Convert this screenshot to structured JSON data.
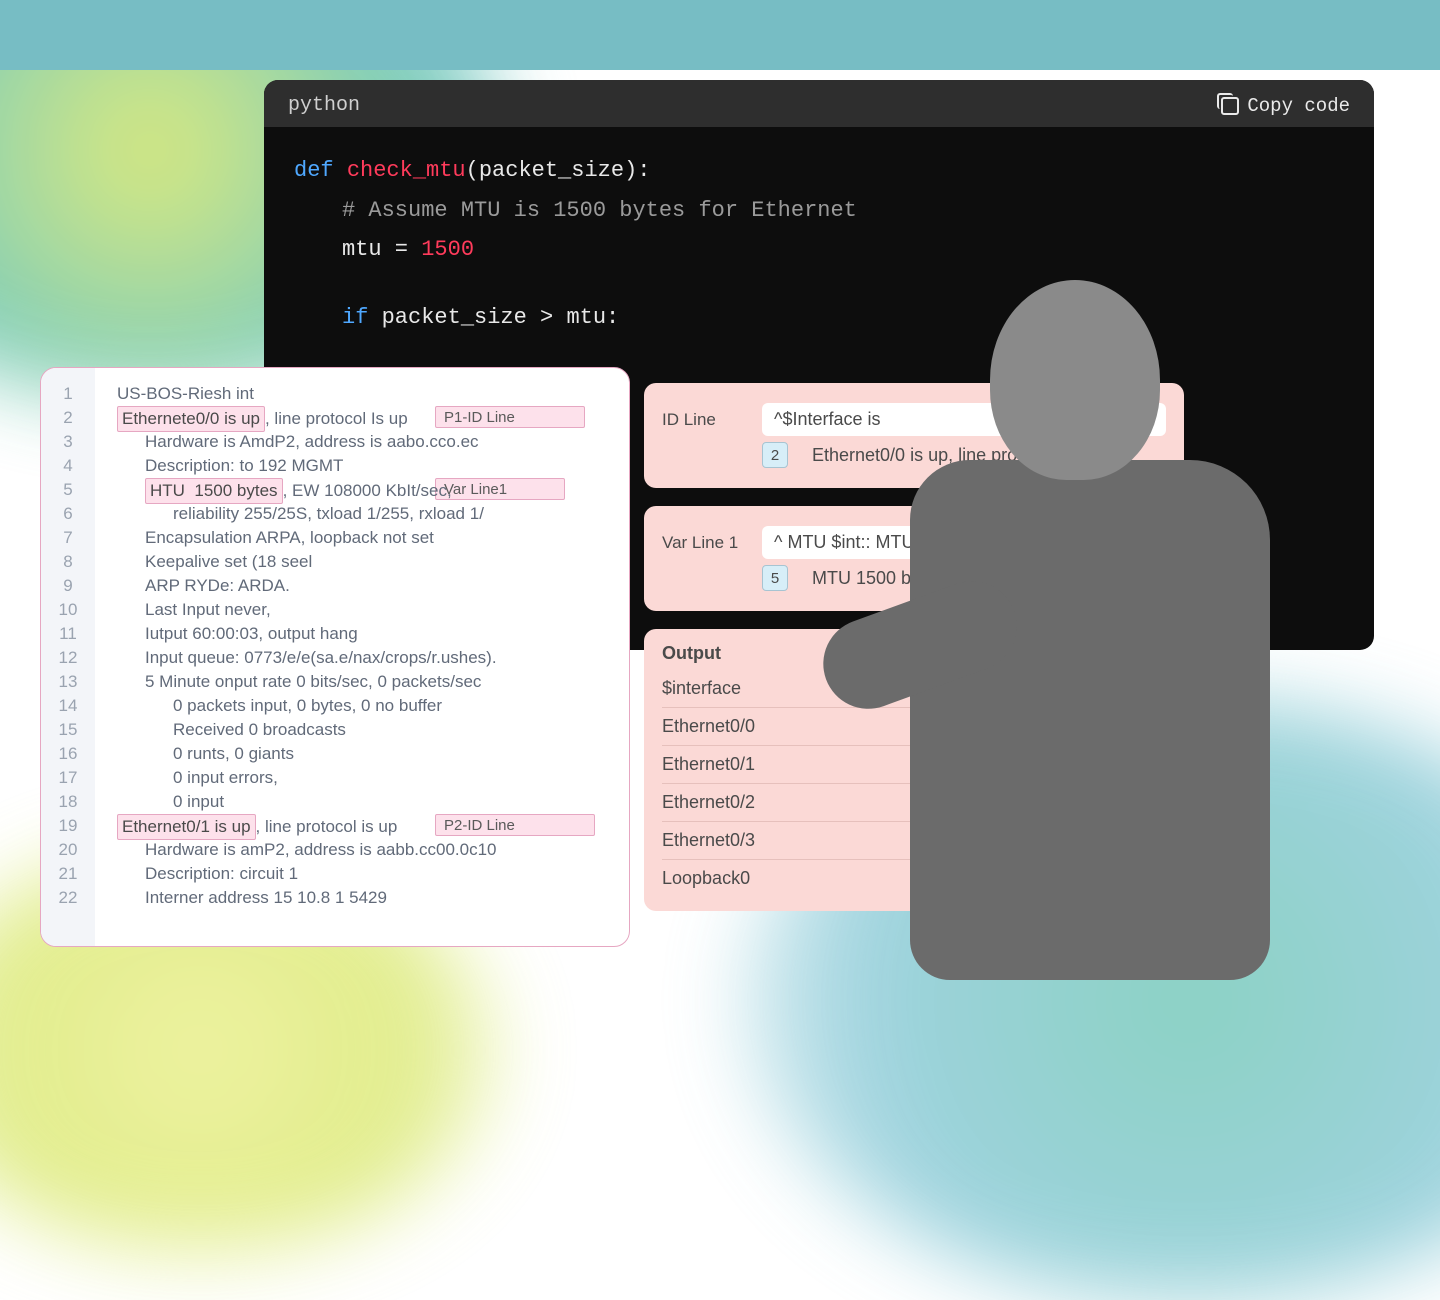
{
  "code_panel": {
    "language_label": "python",
    "copy_label": "Copy code",
    "code": {
      "kw_def": "def",
      "fn": "check_mtu",
      "args": "(packet_size):",
      "comment": "# Assume MTU is 1500 bytes for Ethernet",
      "assign_lhs": "mtu = ",
      "assign_num": "1500",
      "kw_if": "if",
      "cond": " packet_size > mtu:"
    }
  },
  "left_panel": {
    "line_numbers": [
      "1",
      "2",
      "3",
      "4",
      "5",
      "6",
      "7",
      "8",
      "9",
      "10",
      "11",
      "12",
      "13",
      "14",
      "15",
      "16",
      "17",
      "18",
      "19",
      "20",
      "21",
      "22"
    ],
    "lines": [
      {
        "indent": 0,
        "text": "US-BOS-Riesh int"
      },
      {
        "indent": 0,
        "hl": "Ethernete0/0 is up",
        "rest": ", line protocol Is up"
      },
      {
        "indent": 1,
        "text": "Hardware is AmdP2, address is aabo.cco.ec"
      },
      {
        "indent": 1,
        "text": "Description: to 192 MGMT"
      },
      {
        "indent": 1,
        "hl": "HTU  1500 bytes",
        "rest": ", EW 108000 KbIt/sec,"
      },
      {
        "indent": 2,
        "text": "reliability 255/25S, txload 1/255, rxload 1/"
      },
      {
        "indent": 1,
        "text": "Encapsulation ARPA, loopback not set"
      },
      {
        "indent": 1,
        "text": "Keepalive set (18 seel"
      },
      {
        "indent": 1,
        "text": "ARP RYDe: ARDA."
      },
      {
        "indent": 1,
        "text": "Last Input never,"
      },
      {
        "indent": 1,
        "text": "Iutput 60:00:03, output hang"
      },
      {
        "indent": 1,
        "text": "Input queue: 0773/e/e(sa.e/nax/crops/r.ushes)."
      },
      {
        "indent": 1,
        "text": "5 Minute onput rate 0 bits/sec, 0 packets/sec"
      },
      {
        "indent": 2,
        "text": "0 packets input, 0 bytes, 0 no buffer"
      },
      {
        "indent": 2,
        "text": "Received 0 broadcasts"
      },
      {
        "indent": 2,
        "text": "0 runts, 0 giants"
      },
      {
        "indent": 2,
        "text": "0 input errors,"
      },
      {
        "indent": 2,
        "text": "0 input"
      },
      {
        "indent": 0,
        "hl": "Ethernet0/1 is up",
        "rest": ", line protocol is up"
      },
      {
        "indent": 1,
        "text": "Hardware is amP2, address is aabb.cc00.0c10"
      },
      {
        "indent": 1,
        "text": "Description: circuit 1"
      },
      {
        "indent": 1,
        "text": "Interner address 15 10.8 1 5429"
      }
    ],
    "tags": {
      "line2": "P1-ID Line",
      "line5": "Var Line1",
      "line19": "P2-ID Line"
    }
  },
  "right_stack": {
    "id_card": {
      "label": "ID Line",
      "regex": "^$Interface is",
      "match_num": "2",
      "match_text": "Ethernet0/0 is up, line protocol is up"
    },
    "var_card": {
      "label": "Var Line 1",
      "regex": "^  MTU $int:: MTU byte",
      "match_num": "5",
      "match_text": "MTU 1500 byte"
    },
    "output_card": {
      "title": "Output",
      "header": "$interface",
      "rows": [
        "Ethernet0/0",
        "Ethernet0/1",
        "Ethernet0/2",
        "Ethernet0/3",
        "Loopback0"
      ]
    }
  }
}
